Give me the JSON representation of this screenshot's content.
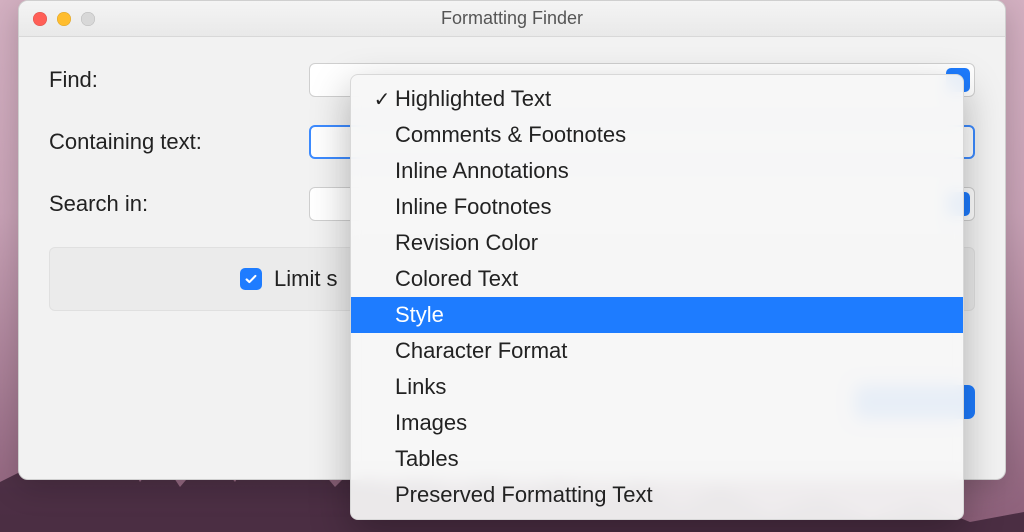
{
  "window": {
    "title": "Formatting Finder"
  },
  "form": {
    "find_label": "Find:",
    "containing_label": "Containing text:",
    "containing_value": "",
    "searchin_label": "Search in:",
    "limit_checked": true,
    "limit_label_visible": "Limit s"
  },
  "dropdown": {
    "selected_index": 0,
    "highlighted_index": 6,
    "items": [
      {
        "label": "Highlighted Text"
      },
      {
        "label": "Comments & Footnotes"
      },
      {
        "label": "Inline Annotations"
      },
      {
        "label": "Inline Footnotes"
      },
      {
        "label": "Revision Color"
      },
      {
        "label": "Colored Text"
      },
      {
        "label": "Style"
      },
      {
        "label": "Character Format"
      },
      {
        "label": "Links"
      },
      {
        "label": "Images"
      },
      {
        "label": "Tables"
      },
      {
        "label": "Preserved Formatting Text"
      }
    ]
  }
}
